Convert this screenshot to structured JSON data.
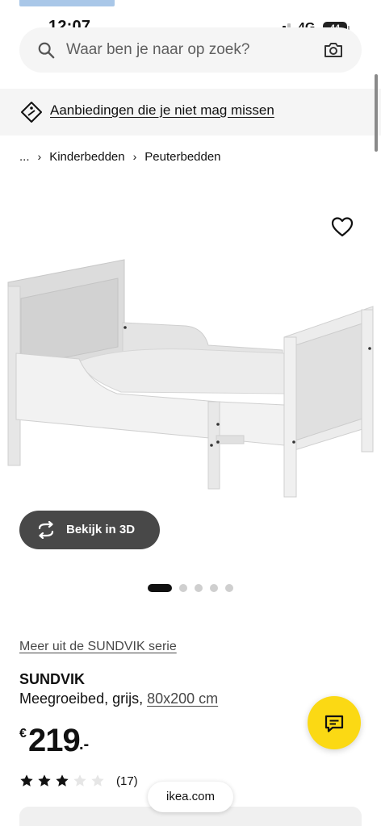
{
  "status_bar": {
    "time": "12:07",
    "network": "4G",
    "battery": "44"
  },
  "search": {
    "placeholder": "Waar ben je naar op zoek?",
    "search_icon": "search-icon",
    "camera_icon": "camera-icon"
  },
  "promo": {
    "text": "Aanbiedingen die je niet mag missen",
    "icon": "tag-icon"
  },
  "breadcrumb": {
    "items": [
      "...",
      "Kinderbedden",
      "Peuterbedden"
    ]
  },
  "gallery": {
    "favorite_icon": "heart-icon",
    "view_3d_label": "Bekijk in 3D",
    "view_3d_icon": "rotate-360-icon",
    "slide_count": 5,
    "active_slide": 1
  },
  "product": {
    "series_link": "Meer uit de SUNDVIK serie",
    "name": "SUNDVIK",
    "description_prefix": "Meegroeibed, grijs, ",
    "size": "80x200 cm",
    "price_currency": "€",
    "price_amount": "219",
    "price_decimals": ".-",
    "rating": 3,
    "rating_max": 5,
    "review_count": "(17)"
  },
  "chat": {
    "icon": "chat-icon"
  },
  "browser": {
    "url": "ikea.com"
  },
  "colors": {
    "accent_yellow": "#fbd914",
    "dark_button": "#484848",
    "banner_bg": "#f5f5f5"
  }
}
